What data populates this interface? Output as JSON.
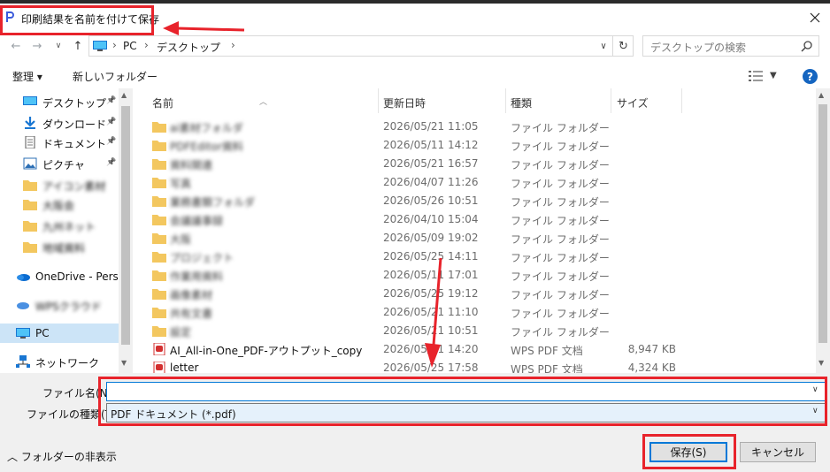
{
  "window": {
    "title": "印刷結果を名前を付けて保存"
  },
  "address": {
    "parts": [
      "PC",
      "デスクトップ"
    ],
    "search_placeholder": "デスクトップの検索"
  },
  "toolbar": {
    "organize": "整理 ▾",
    "new_folder": "新しいフォルダー"
  },
  "nav": {
    "items": [
      {
        "label": "デスクトップ",
        "icon": "desktop-icon",
        "pinned": true
      },
      {
        "label": "ダウンロード",
        "icon": "download-icon",
        "pinned": true
      },
      {
        "label": "ドキュメント",
        "icon": "document-icon",
        "pinned": true
      },
      {
        "label": "ピクチャ",
        "icon": "picture-icon",
        "pinned": true
      },
      {
        "label": "アイコン素材",
        "icon": "folder-icon",
        "pinned": false
      },
      {
        "label": "大阪会",
        "icon": "folder-icon",
        "pinned": false
      },
      {
        "label": "九州ネット",
        "icon": "folder-icon",
        "pinned": false
      },
      {
        "label": "地域資料",
        "icon": "folder-icon",
        "pinned": false
      },
      {
        "label": "OneDrive - Persor",
        "icon": "onedrive-icon",
        "pinned": false
      },
      {
        "label": "WPSクラウド",
        "icon": "cloud-icon",
        "pinned": false
      },
      {
        "label": "PC",
        "icon": "pc-icon",
        "pinned": false,
        "selected": true
      },
      {
        "label": "ネットワーク",
        "icon": "network-icon",
        "pinned": false
      }
    ]
  },
  "columns": {
    "name": "名前",
    "date": "更新日時",
    "type": "種類",
    "size": "サイズ"
  },
  "files": [
    {
      "name": "ai素材フォルダ",
      "date": "2026/05/21 11:05",
      "type": "ファイル フォルダー",
      "size": "",
      "kind": "folder",
      "blur": true
    },
    {
      "name": "PDFEditor資料",
      "date": "2026/05/11 14:12",
      "type": "ファイル フォルダー",
      "size": "",
      "kind": "folder",
      "blur": true
    },
    {
      "name": "資料関連",
      "date": "2026/05/21 16:57",
      "type": "ファイル フォルダー",
      "size": "",
      "kind": "folder",
      "blur": true
    },
    {
      "name": "写真",
      "date": "2026/04/07 11:26",
      "type": "ファイル フォルダー",
      "size": "",
      "kind": "folder",
      "blur": true
    },
    {
      "name": "業務書類フォルダ",
      "date": "2026/05/26 10:51",
      "type": "ファイル フォルダー",
      "size": "",
      "kind": "folder",
      "blur": true
    },
    {
      "name": "会議議事録",
      "date": "2026/04/10 15:04",
      "type": "ファイル フォルダー",
      "size": "",
      "kind": "folder",
      "blur": true
    },
    {
      "name": "大阪",
      "date": "2026/05/09 19:02",
      "type": "ファイル フォルダー",
      "size": "",
      "kind": "folder",
      "blur": true
    },
    {
      "name": "プロジェクト",
      "date": "2026/05/25 14:11",
      "type": "ファイル フォルダー",
      "size": "",
      "kind": "folder",
      "blur": true
    },
    {
      "name": "作業用資料",
      "date": "2026/05/11 17:01",
      "type": "ファイル フォルダー",
      "size": "",
      "kind": "folder",
      "blur": true
    },
    {
      "name": "画像素材",
      "date": "2026/05/25 19:12",
      "type": "ファイル フォルダー",
      "size": "",
      "kind": "folder",
      "blur": true
    },
    {
      "name": "共有文書",
      "date": "2026/05/21 11:10",
      "type": "ファイル フォルダー",
      "size": "",
      "kind": "folder",
      "blur": true
    },
    {
      "name": "設定",
      "date": "2026/05/21 10:51",
      "type": "ファイル フォルダー",
      "size": "",
      "kind": "folder",
      "blur": true
    },
    {
      "name": "AI_All-in-One_PDF-アウトプット_copy",
      "date": "2026/05/21 14:20",
      "type": "WPS PDF 文档",
      "size": "8,947 KB",
      "kind": "pdf",
      "blur": false
    },
    {
      "name": "letter",
      "date": "2026/05/25 17:58",
      "type": "WPS PDF 文档",
      "size": "4,324 KB",
      "kind": "pdf",
      "blur": false
    }
  ],
  "form": {
    "filename_label": "ファイル名(N):",
    "filename_value": "",
    "filetype_label": "ファイルの種類(T):",
    "filetype_value": "PDF ドキュメント (*.pdf)"
  },
  "footer": {
    "hide_folders": "フォルダーの非表示",
    "save": "保存(S)",
    "cancel": "キャンセル"
  },
  "colors": {
    "accent": "#0078d7",
    "annotation": "#e8232b",
    "folder": "#f3c75f",
    "pdf": "#d32f2f"
  }
}
